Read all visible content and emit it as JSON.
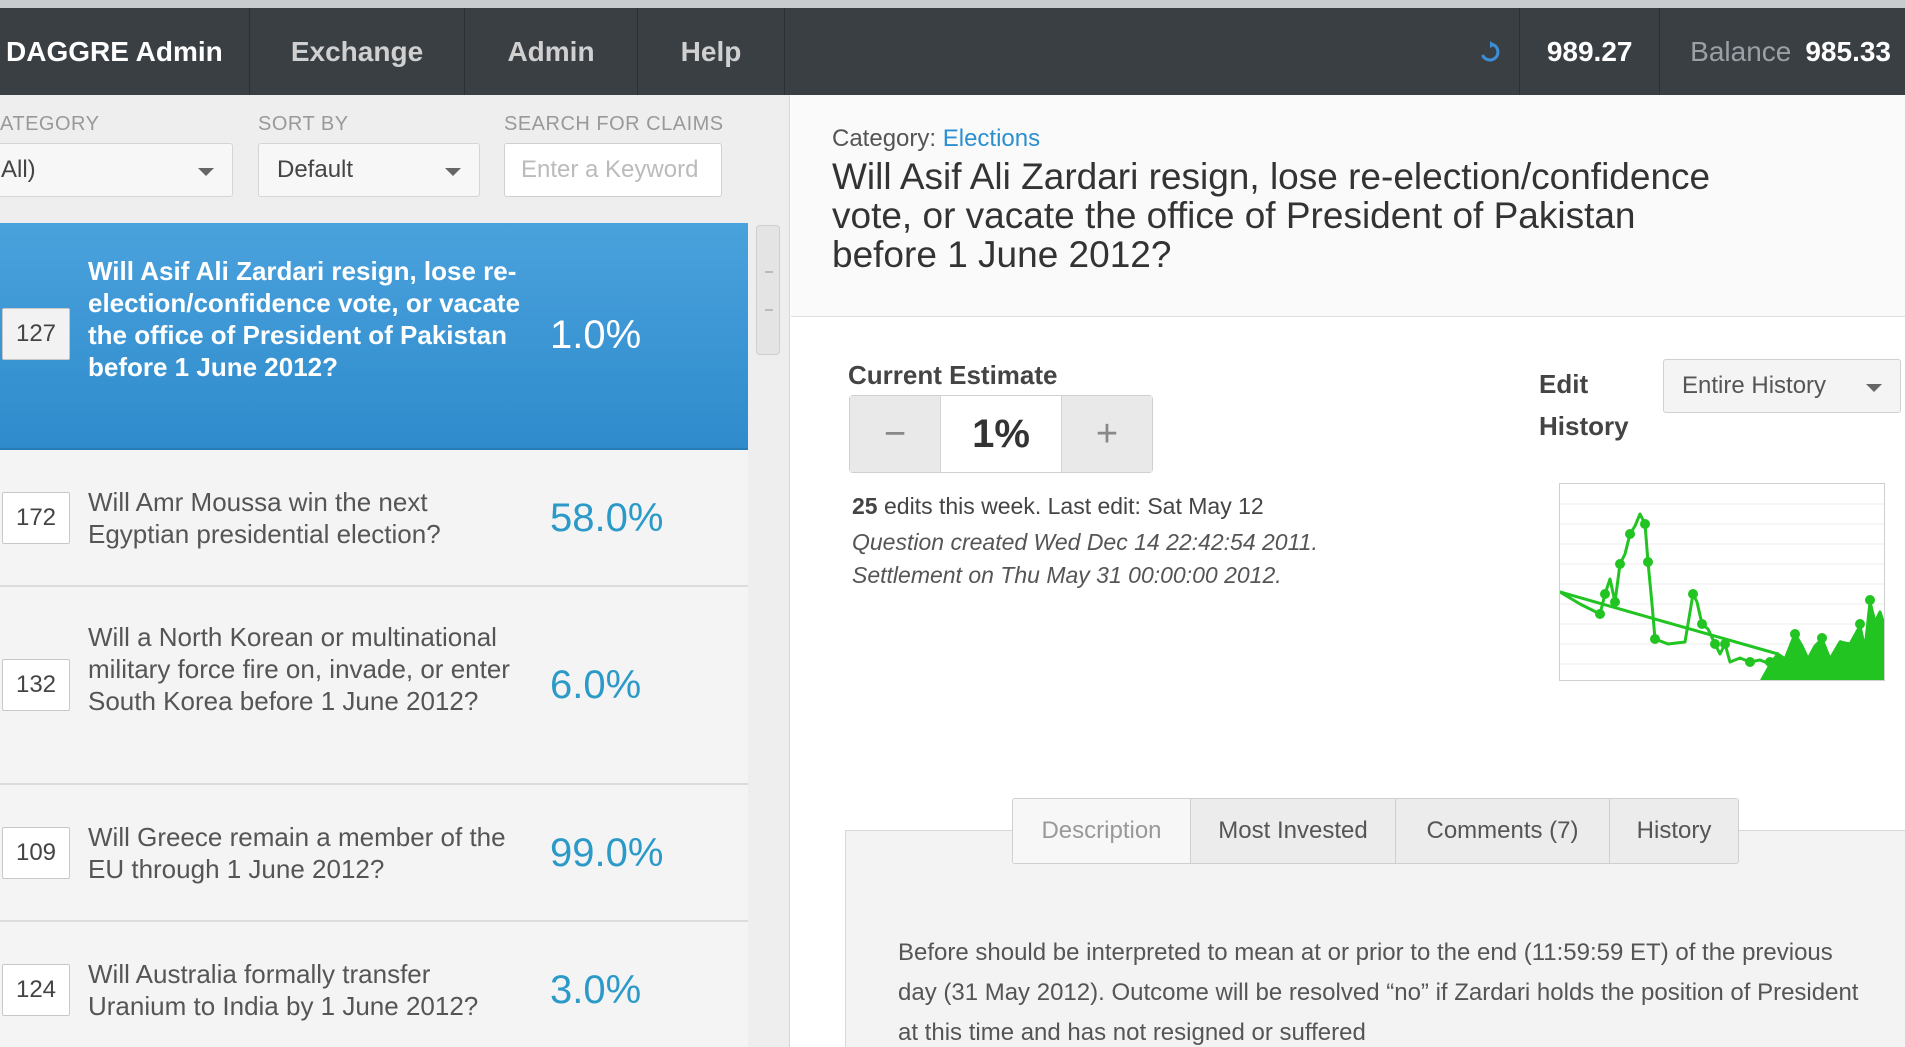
{
  "nav": {
    "brand": "DAGGRE Admin",
    "exchange": "Exchange",
    "admin": "Admin",
    "help": "Help",
    "refresh_icon": "refresh-icon",
    "score": "989.27",
    "balance_label": "Balance",
    "balance_value": "985.33"
  },
  "filters": {
    "category_label": "ATEGORY",
    "category_value": "All)",
    "sort_label": "SORT BY",
    "sort_value": "Default",
    "search_label": "SEARCH FOR CLAIMS",
    "search_placeholder": "Enter a Keyword"
  },
  "claims": [
    {
      "id": "127",
      "text": "Will Asif Ali Zardari resign, lose re-election/confidence vote, or vacate the office of President of Pakistan before 1 June 2012?",
      "percent": "1.0%",
      "active": true
    },
    {
      "id": "172",
      "text": "Will Amr Moussa win the next Egyptian presidential election?",
      "percent": "58.0%",
      "active": false
    },
    {
      "id": "132",
      "text": "Will a North Korean or multinational military force fire on, invade, or enter South Korea before 1 June 2012?",
      "percent": "6.0%",
      "active": false
    },
    {
      "id": "109",
      "text": "Will Greece remain a member of the EU through 1 June 2012?",
      "percent": "99.0%",
      "active": false
    },
    {
      "id": "124",
      "text": "Will Australia formally transfer Uranium to India by 1 June 2012?",
      "percent": "3.0%",
      "active": false
    }
  ],
  "detail": {
    "category_label": "Category:",
    "category_value": "Elections",
    "title": "Will Asif Ali Zardari resign, lose re-election/confidence vote, or vacate the office of President of Pakistan before 1 June 2012?",
    "estimate_label": "Current Estimate",
    "minus": "−",
    "plus": "+",
    "estimate_value": "1%",
    "edits_count": "25",
    "edits_text": " edits this week. Last edit: Sat May 12",
    "created": "Question created Wed Dec 14 22:42:54 2011.",
    "settlement": "Settlement on Thu May 31 00:00:00 2012.",
    "edit_history_line1": "Edit",
    "edit_history_line2": "History",
    "history_select": "Entire History",
    "chart_color": "#22c422",
    "tabs": [
      {
        "label": "Description",
        "active": true
      },
      {
        "label": "Most Invested",
        "active": false
      },
      {
        "label": "Comments (7)",
        "active": false
      },
      {
        "label": "History",
        "active": false
      }
    ],
    "description": "Before should be interpreted to mean at or prior to the end (11:59:59 ET) of the previous day (31 May 2012). Outcome will be resolved “no” if Zardari holds the position of President at this time and has not resigned or suffered"
  }
}
